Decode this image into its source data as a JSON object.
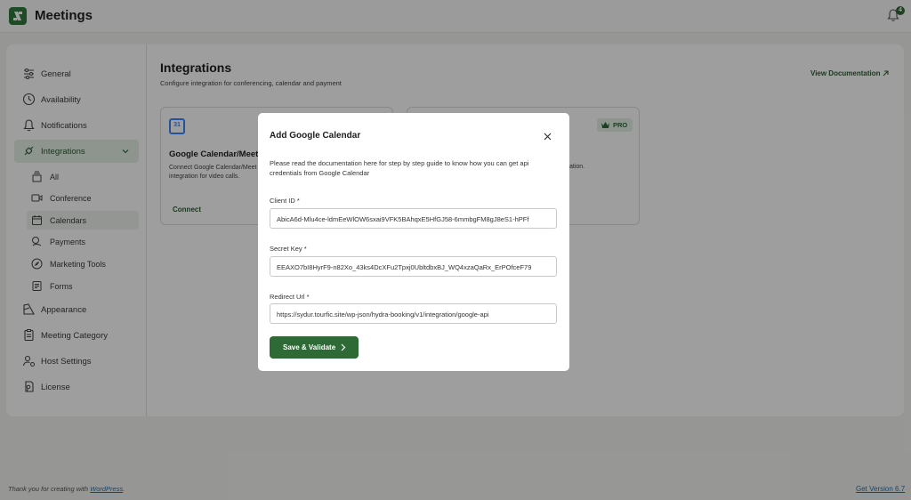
{
  "app": {
    "title": "Meetings",
    "notification_count": "4"
  },
  "sidebar": {
    "items": [
      {
        "label": "General",
        "icon": "sliders-icon"
      },
      {
        "label": "Availability",
        "icon": "clock-icon"
      },
      {
        "label": "Notifications",
        "icon": "bell-icon"
      },
      {
        "label": "Integrations",
        "icon": "plug-icon",
        "expanded": true
      },
      {
        "label": "Appearance",
        "icon": "palette-icon"
      },
      {
        "label": "Meeting Category",
        "icon": "clipboard-icon"
      },
      {
        "label": "Host Settings",
        "icon": "user-gear-icon"
      },
      {
        "label": "License",
        "icon": "license-icon"
      }
    ],
    "sub_items": [
      {
        "label": "All",
        "icon": "layers-icon"
      },
      {
        "label": "Conference",
        "icon": "video-icon"
      },
      {
        "label": "Calendars",
        "icon": "calendar-icon",
        "active": true
      },
      {
        "label": "Payments",
        "icon": "payments-icon"
      },
      {
        "label": "Marketing Tools",
        "icon": "compass-icon"
      },
      {
        "label": "Forms",
        "icon": "form-icon"
      }
    ]
  },
  "main": {
    "title": "Integrations",
    "subtitle": "Configure integration for conferencing, calendar and payment",
    "view_doc": "View Documentation",
    "cards": [
      {
        "title": "Google Calendar/Meet",
        "desc": "Connect Google Calendar/Meet integration for video calls.",
        "link": "Connect",
        "icon_text": "31"
      },
      {
        "badge": "PRO",
        "desc": "ation."
      }
    ]
  },
  "modal": {
    "title": "Add Google Calendar",
    "description": "Please read the documentation here for step by step guide to know how you can get api credentials from Google Calendar",
    "fields": [
      {
        "label": "Client ID *",
        "value": "AbicA6d-Mlu4ce-ldmEeWlOW6sxai9VFK5BAhqxE5HfGJ58-6mmbgFM8gJ8eS1-hPFf"
      },
      {
        "label": "Secret Key *",
        "value": "EEAXO7bI8HyrF9-n82Xo_43ks4DcXFu2Tpxj0UbltdbxBJ_WQ4xzaQaRx_ErPOfceF79"
      },
      {
        "label": "Redirect Url *",
        "value": "https://sydur.tourfic.site/wp-json/hydra-booking/v1/integration/google-api"
      }
    ],
    "save_label": "Save & Validate"
  },
  "footer": {
    "thanks_prefix": "Thank you for creating with ",
    "thanks_link": "WordPress",
    "thanks_suffix": ".",
    "version": "Get Version 6.7"
  },
  "colors": {
    "brand": "#2d6a35",
    "link": "#2271b1"
  }
}
